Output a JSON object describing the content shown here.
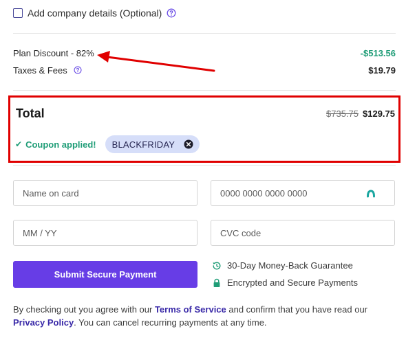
{
  "company": {
    "label": "Add company details (Optional)",
    "checked": false,
    "help_icon": "question-circle-icon"
  },
  "summary": {
    "discount_label": "Plan Discount - 82%",
    "discount_amount": "-$513.56",
    "taxes_label": "Taxes & Fees",
    "taxes_amount": "$19.79",
    "taxes_help_icon": "question-circle-icon"
  },
  "total": {
    "label": "Total",
    "original_price": "$735.75",
    "final_price": "$129.75",
    "coupon_status": "Coupon applied!",
    "coupon_code": "BLACKFRIDAY",
    "remove_icon": "close-circle-icon"
  },
  "payment_form": {
    "name_placeholder": "Name on card",
    "card_number_placeholder": "0000 0000 0000 0000",
    "expiry_placeholder": "MM / YY",
    "cvc_placeholder": "CVC code",
    "submit_label": "Submit Secure Payment"
  },
  "guarantees": [
    {
      "icon": "history-clock-icon",
      "text": "30-Day Money-Back Guarantee"
    },
    {
      "icon": "lock-icon",
      "text": "Encrypted and Secure Payments"
    }
  ],
  "legal": {
    "prefix": "By checking out you agree with our ",
    "terms_link": "Terms of Service",
    "middle": " and confirm that you have read our ",
    "privacy_link": "Privacy Policy",
    "suffix": ". You can cancel recurring payments at any time."
  },
  "colors": {
    "accent": "#673de6",
    "discount_green": "#1f9d77",
    "annotation_red": "#e00000",
    "chip_background": "#d6def9"
  }
}
